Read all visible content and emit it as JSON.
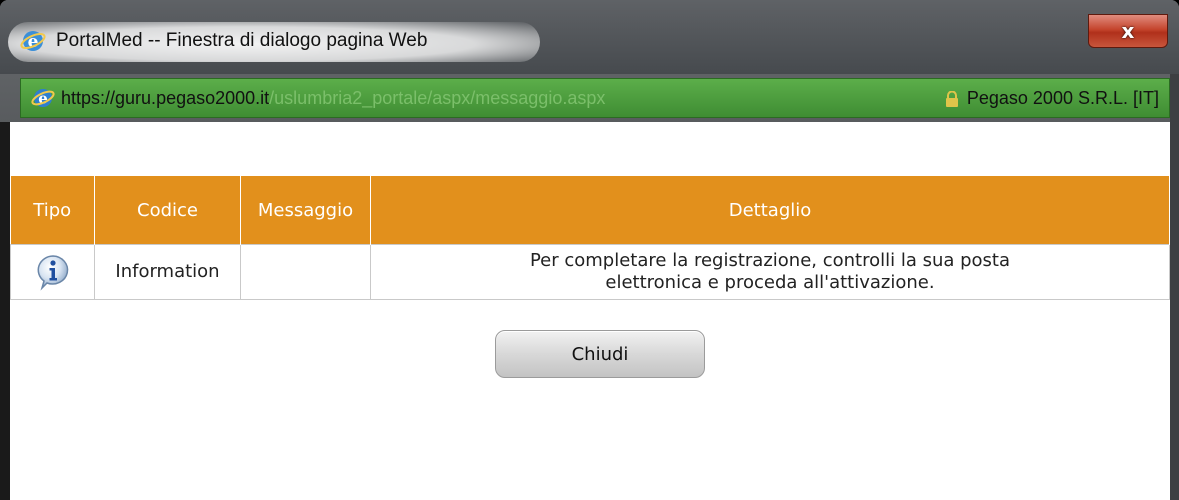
{
  "window": {
    "title": "PortalMed -- Finestra di dialogo pagina Web",
    "close_label": "x"
  },
  "address": {
    "url_prefix": "https://guru.",
    "url_domain": "pegaso2000.it",
    "url_path": "/uslumbria2_portale/aspx/messaggio.aspx",
    "certificate": "Pegaso 2000 S.R.L. [IT]"
  },
  "table": {
    "headers": [
      "Tipo",
      "Codice",
      "Messaggio",
      "Dettaglio"
    ],
    "rows": [
      {
        "tipo_icon": "info-icon",
        "codice": "Information",
        "messaggio": "",
        "dettaglio": "Per completare la registrazione, controlli la sua posta elettronica e proceda all'attivazione."
      }
    ]
  },
  "actions": {
    "close_button": "Chiudi"
  },
  "colors": {
    "header_bg": "#e2901c",
    "address_bar": "#4a9c3c",
    "close_window_button": "#c5452d"
  }
}
